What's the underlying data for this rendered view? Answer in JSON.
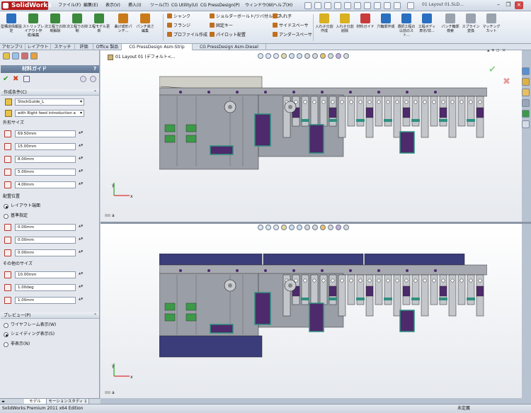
{
  "app": {
    "title": "SolidWorks",
    "window_title": "01 Layout 01.SLD..."
  },
  "menus": [
    "ファイル(F)",
    "編集(E)",
    "表示(V)",
    "挿入(I)",
    "ツール(T)",
    "CG Utility(U)",
    "CG PressDesign(P)",
    "ウィンドウ(W)",
    "ヘルプ(H)"
  ],
  "ribbon": {
    "big_buttons": [
      {
        "label": "型構造情報設定",
        "color": "#2b6fc0"
      },
      {
        "label": "ストリップレイアウト作成/編集",
        "color": "#3c8a3c"
      },
      {
        "label": "次工程での抑制解除",
        "color": "#3c8a3c"
      },
      {
        "label": "次工程での抑制",
        "color": "#3c8a3c"
      },
      {
        "label": "工程モデル更新",
        "color": "#3c8a3c"
      },
      {
        "label": "曲げ成形パンチ...",
        "color": "#c97b1a"
      },
      {
        "label": "パンチ高さ編集",
        "color": "#c97b1a"
      }
    ],
    "small_col1": [
      {
        "label": "シャンク",
        "color": "#c06f1e"
      },
      {
        "label": "フランジ",
        "color": "#c06f1e"
      },
      {
        "label": "プロファイル作成",
        "color": "#c06f1e"
      }
    ],
    "small_col2": [
      {
        "label": "ショルダーボールト/ツバ付ループ",
        "color": "#c06f1e"
      },
      {
        "label": "固定キー",
        "color": "#c06f1e"
      },
      {
        "label": "パイロット配置",
        "color": "#c06f1e"
      }
    ],
    "small_col3": [
      {
        "label": "入れ子",
        "color": "#c06f1e"
      },
      {
        "label": "サイドスペーサ",
        "color": "#c06f1e"
      },
      {
        "label": "アンダースペーサ",
        "color": "#c06f1e"
      }
    ],
    "big_buttons2": [
      {
        "label": "入れ子分割作成",
        "color": "#d8b020"
      },
      {
        "label": "入れ子分割削除",
        "color": "#d8b020"
      },
      {
        "label": "材料ガイド",
        "color": "#c93a3a"
      },
      {
        "label": "穴輪郭作成",
        "color": "#2b6fc0"
      },
      {
        "label": "選択工程の以前のスト...",
        "color": "#2b6fc0"
      },
      {
        "label": "工程ボディ表示/非...",
        "color": "#2b6fc0"
      },
      {
        "label": "パンチ輪郭検索",
        "color": "#9aa3ad"
      },
      {
        "label": "スプライン変換",
        "color": "#9aa3ad"
      },
      {
        "label": "マッチングカット",
        "color": "#9aa3ad"
      }
    ]
  },
  "tabs": [
    "アセンブリ",
    "レイアウト",
    "スケッチ",
    "評価",
    "Office 製品",
    "CG PressDesign Asm-Strip",
    "CG PressDesign Asm-Diesel"
  ],
  "selected_tab": "CG PressDesign Asm-Strip",
  "panel": {
    "title": "材料ガイド",
    "help": "?",
    "section1": "作成条件(C)",
    "combo1": "StockGuide_L",
    "combo2": "with Right feed introduction a",
    "outer_size_label": "外形サイズ",
    "outer_values": [
      "69.50mm",
      "15.00mm",
      "8.00mm",
      "5.00mm",
      "4.00mm"
    ],
    "placement_label": "配置位置",
    "radio_layout": "レイアウト端面",
    "radio_ref": "基準指定",
    "placement_values": [
      "0.00mm",
      "0.00mm",
      "0.00mm"
    ],
    "other_label": "その他のサイズ",
    "other_values": [
      "10.00mm",
      "1.00deg",
      "1.00mm"
    ],
    "section2": "プレビュー(P)",
    "preview_options": [
      "ワイヤフレーム表示(W)",
      "シェイディング表示(S)",
      "非表示(N)"
    ],
    "preview_selected": 1
  },
  "bottom_tabs": [
    "モデル",
    "モーションスタディ 1"
  ],
  "tree_item": "01 Layout 01  (デフォルト<...",
  "view_label_a": "a",
  "status": {
    "left": "SolidWorks Premium 2011 x64 Edition",
    "right": "未定義"
  },
  "colors": {
    "plate": "#9a9ea6",
    "purple": "#4d2a6b",
    "plate_blue": "#3b3d7a",
    "teal": "#2f8f80"
  }
}
